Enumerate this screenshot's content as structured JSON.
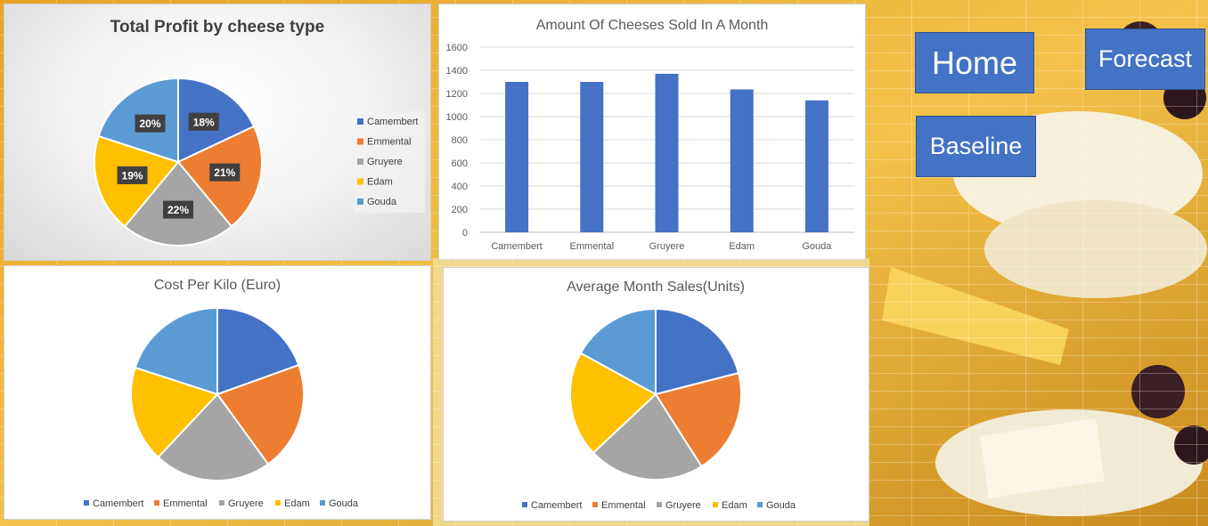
{
  "nav": {
    "home_label": "Home",
    "forecast_label": "Forecast",
    "baseline_label": "Baseline"
  },
  "colors": {
    "camembert": "#4472c4",
    "emmental": "#ed7d31",
    "gruyere": "#a5a5a5",
    "edam": "#ffc000",
    "gouda": "#5b9bd5",
    "bar": "#4472c4",
    "button": "#4472c4"
  },
  "chart_data": [
    {
      "id": "profit",
      "type": "pie",
      "title": "Total Profit by cheese type",
      "categories": [
        "Camembert",
        "Emmental",
        "Gruyere",
        "Edam",
        "Gouda"
      ],
      "values": [
        18,
        21,
        22,
        19,
        20
      ],
      "data_labels": [
        "18%",
        "21%",
        "22%",
        "19%",
        "20%"
      ],
      "legend": "right"
    },
    {
      "id": "sold",
      "type": "bar",
      "title": "Amount Of Cheeses Sold In A Month",
      "categories": [
        "Camembert",
        "Emmental",
        "Gruyere",
        "Edam",
        "Gouda"
      ],
      "values": [
        1300,
        1300,
        1370,
        1235,
        1140
      ],
      "ylim": [
        0,
        1600
      ],
      "yticks": [
        0,
        200,
        400,
        600,
        800,
        1000,
        1200,
        1400,
        1600
      ],
      "xlabel": "",
      "ylabel": "",
      "grid": true,
      "legend": "none"
    },
    {
      "id": "cost",
      "type": "pie",
      "title": "Cost Per Kilo (Euro)",
      "categories": [
        "Camembert",
        "Emmental",
        "Gruyere",
        "Edam",
        "Gouda"
      ],
      "values": [
        19.5,
        20.5,
        22,
        18,
        20
      ],
      "legend": "bottom"
    },
    {
      "id": "avg",
      "type": "pie",
      "title": "Average Month Sales(Units)",
      "categories": [
        "Camembert",
        "Emmental",
        "Gruyere",
        "Edam",
        "Gouda"
      ],
      "values": [
        21,
        20,
        22,
        20,
        17
      ],
      "legend": "bottom"
    }
  ]
}
